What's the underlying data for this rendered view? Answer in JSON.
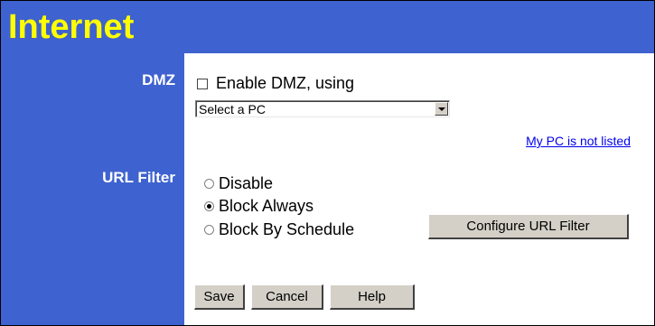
{
  "header": {
    "title": "Internet"
  },
  "sections": {
    "dmz_label": "DMZ",
    "url_filter_label": "URL Filter"
  },
  "dmz": {
    "checkbox_label": "Enable DMZ, using",
    "checked": false,
    "select_value": "Select a PC",
    "not_listed_link": "My PC is not listed"
  },
  "url_filter": {
    "options": [
      "Disable",
      "Block Always",
      "Block By Schedule"
    ],
    "selected": "Block Always",
    "configure_button": "Configure URL Filter"
  },
  "footer": {
    "save": "Save",
    "cancel": "Cancel",
    "help": "Help"
  },
  "colors": {
    "brand_blue": "#3e62cf",
    "title_yellow": "#ffff00",
    "link_blue": "#0000ee"
  }
}
